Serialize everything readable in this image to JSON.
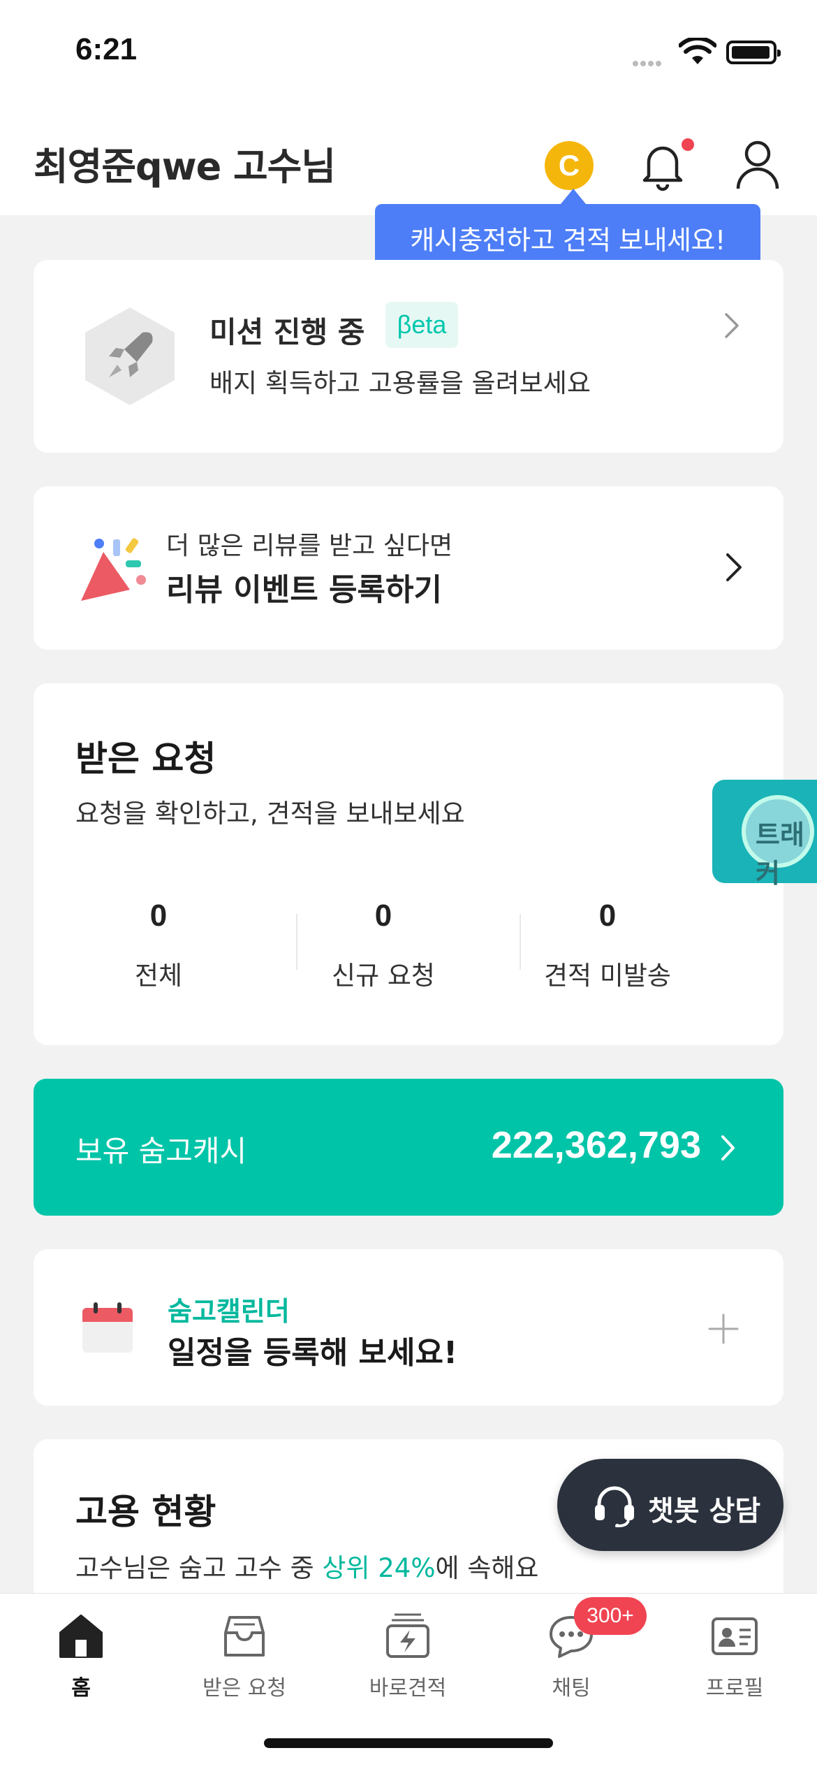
{
  "status_bar": {
    "time": "6:21"
  },
  "header": {
    "title": "최영준qwe 고수님",
    "cash_icon_letter": "C"
  },
  "tooltip": {
    "text": "캐시충전하고 견적 보내세요!"
  },
  "mission": {
    "title": "미션 진행 중",
    "tag": "βeta",
    "subtitle": "배지 획득하고 고용률을 올려보세요"
  },
  "review_event": {
    "subtitle": "더 많은 리뷰를 받고 싶다면",
    "title": "리뷰 이벤트 등록하기"
  },
  "requests": {
    "title": "받은 요청",
    "subtitle": "요청을 확인하고, 견적을 보내보세요",
    "stats": [
      {
        "value": "0",
        "label": "전체"
      },
      {
        "value": "0",
        "label": "신규 요청"
      },
      {
        "value": "0",
        "label": "견적 미발송"
      }
    ]
  },
  "tracker": {
    "label": "트래커"
  },
  "cash": {
    "label": "보유 숨고캐시",
    "amount": "222,362,793"
  },
  "calendar": {
    "title": "숨고캘린더",
    "subtitle": "일정을 등록해 보세요!"
  },
  "employment": {
    "title": "고용 현황",
    "subtitle_prefix": "고수님은 숨고 고수 중 ",
    "subtitle_highlight": "상위 24%",
    "subtitle_suffix": "에 속해요"
  },
  "chatbot": {
    "label": "챗봇 상담"
  },
  "bottom_nav": {
    "items": [
      {
        "label": "홈",
        "icon": "home-icon",
        "active": true
      },
      {
        "label": "받은 요청",
        "icon": "inbox-icon",
        "active": false
      },
      {
        "label": "바로견적",
        "icon": "quick-quote-icon",
        "active": false
      },
      {
        "label": "채팅",
        "icon": "chat-icon",
        "active": false
      },
      {
        "label": "프로필",
        "icon": "profile-card-icon",
        "active": false
      }
    ],
    "chat_badge": "300+"
  },
  "colors": {
    "accent": "#00c4a8",
    "tooltip": "#4d7ef7",
    "badge": "#f04452",
    "coin": "#f5b60b"
  }
}
